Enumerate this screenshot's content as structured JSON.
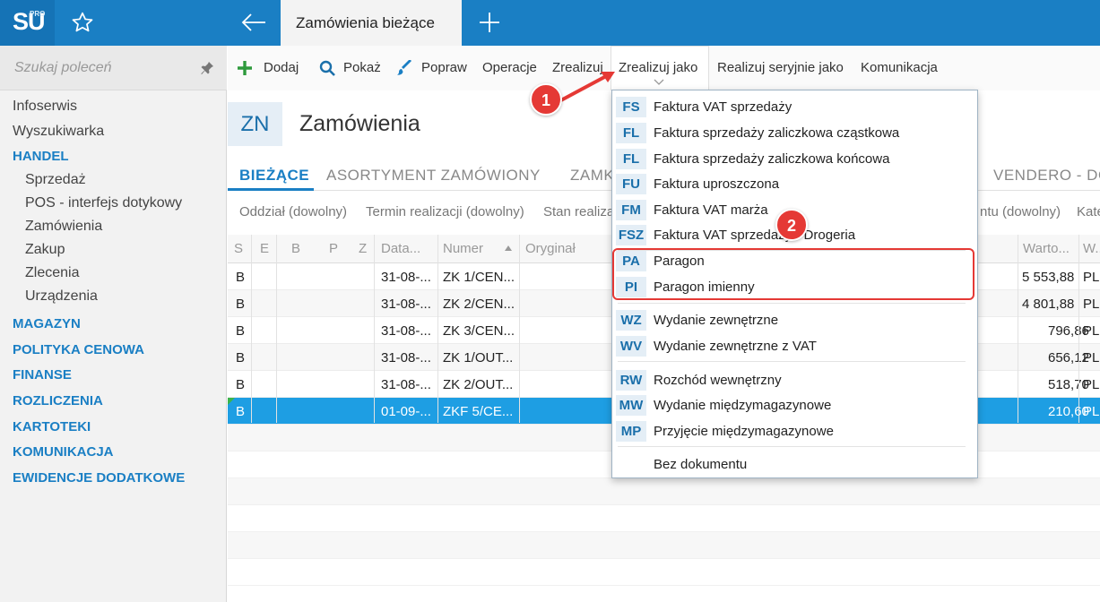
{
  "app": {
    "logo": "SU",
    "logo_sup": "PRO",
    "active_tab": "Zamówienia bieżące"
  },
  "sidebar": {
    "search_placeholder": "Szukaj poleceń",
    "items": [
      {
        "label": "Infoserwis",
        "type": "item"
      },
      {
        "label": "Wyszukiwarka",
        "type": "item"
      },
      {
        "label": "HANDEL",
        "type": "section"
      },
      {
        "label": "Sprzedaż",
        "type": "sub"
      },
      {
        "label": "POS - interfejs dotykowy",
        "type": "sub"
      },
      {
        "label": "Zamówienia",
        "type": "sub"
      },
      {
        "label": "Zakup",
        "type": "sub"
      },
      {
        "label": "Zlecenia",
        "type": "sub"
      },
      {
        "label": "Urządzenia",
        "type": "sub"
      },
      {
        "label": "MAGAZYN",
        "type": "section"
      },
      {
        "label": "POLITYKA CENOWA",
        "type": "section"
      },
      {
        "label": "FINANSE",
        "type": "section"
      },
      {
        "label": "ROZLICZENIA",
        "type": "section"
      },
      {
        "label": "KARTOTEKI",
        "type": "section"
      },
      {
        "label": "KOMUNIKACJA",
        "type": "section"
      },
      {
        "label": "EWIDENCJE DODATKOWE",
        "type": "section"
      }
    ]
  },
  "toolbar": {
    "add": "Dodaj",
    "show": "Pokaż",
    "edit": "Popraw",
    "operations": "Operacje",
    "realize": "Zrealizuj",
    "realize_as": "Zrealizuj jako",
    "realize_serial": "Realizuj seryjnie jako",
    "communication": "Komunikacja"
  },
  "heading": {
    "badge": "ZN",
    "title": "Zamówienia"
  },
  "subtabs": {
    "current": "BIEŻĄCE",
    "assortment": "ASORTYMENT ZAMÓWIONY",
    "closed_partial": "ZAMK",
    "vendero": "VENDERO - DO"
  },
  "filters": {
    "branch": "Oddział (dowolny)",
    "due": "Termin realizacji (dowolny)",
    "state": "Stan realiza",
    "contractor_tail": "ntu (dowolny)",
    "category_tail": "Kate"
  },
  "grid": {
    "headers": {
      "s": "S",
      "e": "E",
      "b": "B",
      "p": "P",
      "z": "Z",
      "date": "Data...",
      "number": "Numer",
      "original": "Oryginał",
      "value": "Warto...",
      "currency": "W..."
    },
    "rows": [
      {
        "s": "B",
        "date": "31-08-...",
        "number": "ZK 1/CEN...",
        "value": "5 553,88",
        "currency": "PL"
      },
      {
        "s": "B",
        "date": "31-08-...",
        "number": "ZK 2/CEN...",
        "value": "4 801,88",
        "currency": "PL"
      },
      {
        "s": "B",
        "date": "31-08-...",
        "number": "ZK 3/CEN...",
        "value": "796,86",
        "currency": "PL"
      },
      {
        "s": "B",
        "date": "31-08-...",
        "number": "ZK 1/OUT...",
        "value": "656,12",
        "currency": "PL"
      },
      {
        "s": "B",
        "date": "31-08-...",
        "number": "ZK 2/OUT...",
        "value": "518,70",
        "currency": "PL"
      },
      {
        "s": "B",
        "date": "01-09-...",
        "number": "ZKF 5/CE...",
        "value": "210,60",
        "currency": "PL"
      }
    ]
  },
  "menu": {
    "items": [
      {
        "code": "FS",
        "label": "Faktura VAT sprzedaży"
      },
      {
        "code": "FL",
        "label": "Faktura sprzedaży zaliczkowa cząstkowa"
      },
      {
        "code": "FL",
        "label": "Faktura sprzedaży zaliczkowa końcowa"
      },
      {
        "code": "FU",
        "label": "Faktura uproszczona"
      },
      {
        "code": "FM",
        "label": "Faktura VAT marża"
      },
      {
        "code": "FSZ",
        "label": "Faktura VAT sprzedaży - Drogeria"
      },
      {
        "code": "PA",
        "label": "Paragon"
      },
      {
        "code": "PI",
        "label": "Paragon imienny"
      },
      {
        "code": "WZ",
        "label": "Wydanie zewnętrzne"
      },
      {
        "code": "WV",
        "label": "Wydanie zewnętrzne z VAT"
      },
      {
        "code": "RW",
        "label": "Rozchód wewnętrzny"
      },
      {
        "code": "MW",
        "label": "Wydanie międzymagazynowe"
      },
      {
        "code": "MP",
        "label": "Przyjęcie międzymagazynowe"
      },
      {
        "code": "",
        "label": "Bez dokumentu"
      }
    ]
  },
  "annotations": {
    "step1": "1",
    "step2": "2"
  },
  "colors": {
    "accent": "#1a7fc4",
    "selected_row": "#1e9ee3",
    "annotation_red": "#e53935"
  }
}
